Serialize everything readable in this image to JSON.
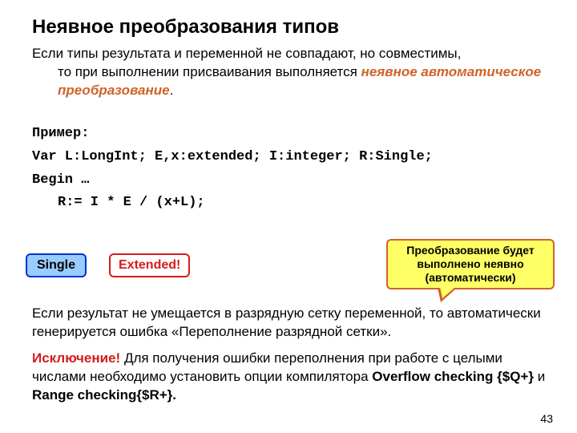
{
  "title": "Неявное преобразования типов",
  "intro": {
    "line1": "Если типы результата и переменной не совпадают, но совместимы,",
    "line2_pre": "то при выполнении присваивания выполняется ",
    "highlight": "неявное автоматическое преобразование",
    "line2_post": "."
  },
  "code": {
    "l1": "Пример:",
    "l2": "Var L:LongInt; E,x:extended; I:integer; R:Single;",
    "l3": "Begin …",
    "l4": "R:= I * E / (x+L);"
  },
  "callouts": {
    "single": "Single",
    "extended": "Extended!",
    "yellow_l1": "Преобразование будет",
    "yellow_l2": "выполнено неявно",
    "yellow_l3": "(автоматически)"
  },
  "para2": "Если результат не умещается в разрядную сетку переменной, то автоматически генерируется ошибка «Переполнение разрядной сетки».",
  "exception": {
    "label": "Исключение!",
    "text_before": " Для получения ошибки переполнения при работе с целыми числами необходимо установить опции компилятора ",
    "opt1": "Overflow checking {$Q+}",
    "mid": " и ",
    "opt2": "Range checking{$R+}.",
    "after": ""
  },
  "page": "43"
}
